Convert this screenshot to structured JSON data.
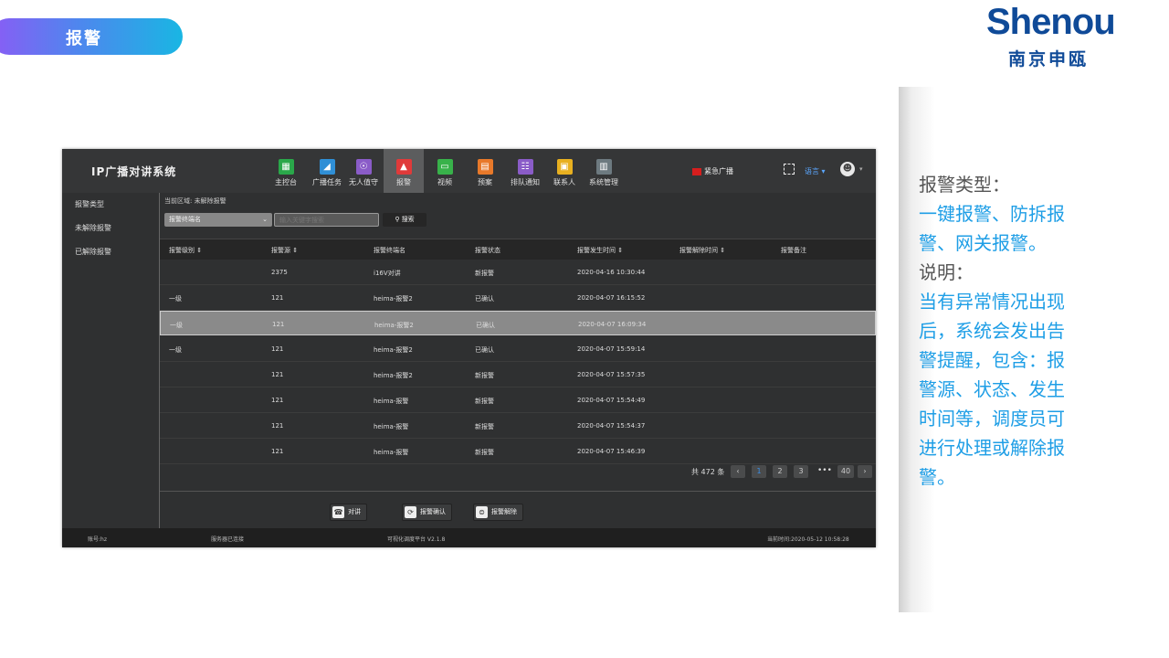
{
  "slide": {
    "section_label": "报警",
    "logo_en": "Shenou",
    "logo_cn": "南京申瓯",
    "notes": [
      {
        "text": "报警类型：",
        "style": "dark"
      },
      {
        "text": "一键报警、防拆报",
        "style": "blue"
      },
      {
        "text": "警、网关报警。",
        "style": "blue"
      },
      {
        "text": "说明：",
        "style": "dark"
      },
      {
        "text": "当有异常情况出现",
        "style": "blue"
      },
      {
        "text": "后，系统会发出告",
        "style": "blue"
      },
      {
        "text": "警提醒，包含：报",
        "style": "blue"
      },
      {
        "text": "警源、状态、发生",
        "style": "blue"
      },
      {
        "text": "时间等，调度员可",
        "style": "blue"
      },
      {
        "text": "进行处理或解除报",
        "style": "blue"
      },
      {
        "text": "警。",
        "style": "blue"
      }
    ]
  },
  "app": {
    "title": "IP广播对讲系统",
    "nav": [
      {
        "label": "主控台",
        "icon": "dashboard-icon",
        "color": "#2aa84a"
      },
      {
        "label": "广播任务",
        "icon": "megaphone-icon",
        "color": "#2f8fd6"
      },
      {
        "label": "无人值守",
        "icon": "unattended-icon",
        "color": "#8a5cc8"
      },
      {
        "label": "报警",
        "icon": "alarm-icon",
        "color": "#e03a3a"
      },
      {
        "label": "视频",
        "icon": "video-icon",
        "color": "#38b24a"
      },
      {
        "label": "预案",
        "icon": "plan-icon",
        "color": "#e8792a"
      },
      {
        "label": "排队通知",
        "icon": "queue-icon",
        "color": "#8a5cc8"
      },
      {
        "label": "联系人",
        "icon": "contacts-icon",
        "color": "#e8b020"
      },
      {
        "label": "系统管理",
        "icon": "system-icon",
        "color": "#6d7a80"
      }
    ],
    "active_nav": "报警",
    "emergency_label": "紧急广播",
    "language_label": "语言 ▾",
    "sidebar": [
      "报警类型",
      "未解除报警",
      "已解除报警"
    ],
    "breadcrumb": "当前区域: 未解除报警",
    "filter": {
      "selected": "报警终端名",
      "search_placeholder": "输入关键字搜索",
      "search_button": "搜索"
    },
    "columns": [
      "报警级别 ⇕",
      "报警源 ⇕",
      "报警终端名",
      "报警状态",
      "报警发生时间 ⇕",
      "报警解除时间 ⇕",
      "报警备注"
    ],
    "rows": [
      {
        "level": "",
        "source": "2375",
        "terminal": "i16V对讲",
        "status": "新报警",
        "time": "2020-04-16 10:30:44",
        "clear_time": "",
        "remark": ""
      },
      {
        "level": "一级",
        "source": "121",
        "terminal": "heima-报警2",
        "status": "已确认",
        "time": "2020-04-07 16:15:52",
        "clear_time": "",
        "remark": ""
      },
      {
        "level": "一级",
        "source": "121",
        "terminal": "heima-报警2",
        "status": "已确认",
        "time": "2020-04-07 16:09:34",
        "clear_time": "",
        "remark": ""
      },
      {
        "level": "一级",
        "source": "121",
        "terminal": "heima-报警2",
        "status": "已确认",
        "time": "2020-04-07 15:59:14",
        "clear_time": "",
        "remark": ""
      },
      {
        "level": "",
        "source": "121",
        "terminal": "heima-报警2",
        "status": "新报警",
        "time": "2020-04-07 15:57:35",
        "clear_time": "",
        "remark": ""
      },
      {
        "level": "",
        "source": "121",
        "terminal": "heima-报警",
        "status": "新报警",
        "time": "2020-04-07 15:54:49",
        "clear_time": "",
        "remark": ""
      },
      {
        "level": "",
        "source": "121",
        "terminal": "heima-报警",
        "status": "新报警",
        "time": "2020-04-07 15:54:37",
        "clear_time": "",
        "remark": ""
      },
      {
        "level": "",
        "source": "121",
        "terminal": "heima-报警",
        "status": "新报警",
        "time": "2020-04-07 15:46:39",
        "clear_time": "",
        "remark": ""
      }
    ],
    "selected_row": 2,
    "pagination": {
      "total": "共 472 条",
      "prev": "‹",
      "pages": [
        "1",
        "2",
        "3"
      ],
      "ellipsis": "•••",
      "last": "40",
      "next": "›",
      "current": "1"
    },
    "actions": [
      {
        "label": "对讲",
        "icon": "intercom-icon"
      },
      {
        "label": "报警确认",
        "icon": "confirm-icon"
      },
      {
        "label": "报警解除",
        "icon": "release-icon"
      }
    ],
    "status": {
      "account": "账号:hz",
      "server": "服务器已连接",
      "platform": "可视化调度平台  V2.1.8",
      "clock": "当前时间:2020-05-12 10:58:28"
    }
  }
}
